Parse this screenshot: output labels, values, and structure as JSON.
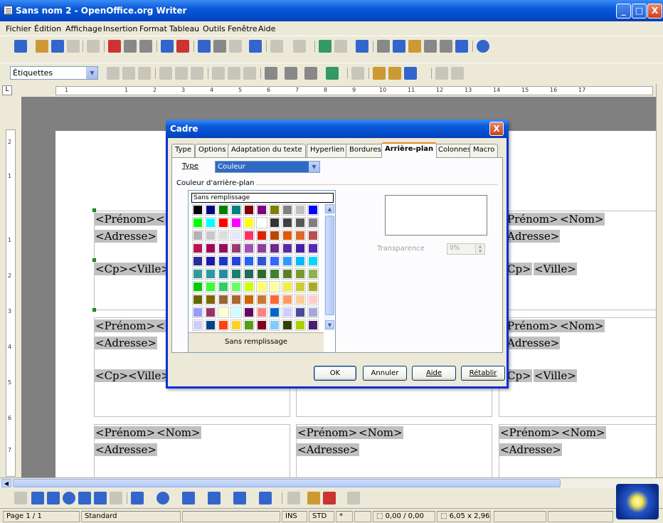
{
  "window": {
    "title": "Sans nom 2 - OpenOffice.org Writer",
    "min": "_",
    "max": "□",
    "close": "X"
  },
  "menu": [
    "Fichier",
    "Édition",
    "Affichage",
    "Insertion",
    "Format",
    "Tableau",
    "Outils",
    "Fenêtre",
    "Aide"
  ],
  "format_toolbar": {
    "style_value": "Étiquettes"
  },
  "ruler": {
    "marks": [
      "1",
      "1",
      "2",
      "3",
      "4",
      "5",
      "6",
      "7",
      "8",
      "9",
      "10",
      "11",
      "12",
      "13",
      "14",
      "15",
      "16",
      "17"
    ]
  },
  "vruler": {
    "marks": [
      "2",
      "1",
      "1",
      "2",
      "3",
      "4",
      "5",
      "6",
      "7"
    ]
  },
  "labels": {
    "prenom": "<Prénom>",
    "nom": "<Nom>",
    "adresse": "<Adresse>",
    "cp": "<Cp>",
    "ville": "<Ville>",
    "prenom_clip": "Prénom>",
    "adresse_clip": "Adresse>",
    "cp_clip": "Cp>",
    "prenom_l": "<Prénom>",
    "prenom_ll": "<"
  },
  "dialog": {
    "title": "Cadre",
    "close": "X",
    "tabs": [
      "Type",
      "Options",
      "Adaptation du texte",
      "Hyperlien",
      "Bordures",
      "Arrière-plan",
      "Colonnes",
      "Macro"
    ],
    "active_tab": "Arrière-plan",
    "type_label": "Type",
    "type_value": "Couleur",
    "group_label": "Couleur d'arrière-plan",
    "no_fill_top": "Sans remplissage",
    "no_fill_caption": "Sans remplissage",
    "transparency_label": "Transparence",
    "transparency_value": "0%",
    "buttons": {
      "ok": "OK",
      "cancel": "Annuler",
      "help": "Aide",
      "reset": "Rétablir"
    }
  },
  "palette_colors": [
    [
      "#000000",
      "#000080",
      "#008000",
      "#008080",
      "#800000",
      "#800080",
      "#808000",
      "#808080",
      "#c0c0c0",
      "#0000ff"
    ],
    [
      "#00ff00",
      "#00ffff",
      "#ff0000",
      "#ff00ff",
      "#ffff00",
      "#ffffff",
      "#333333",
      "#404040",
      "#595959",
      "#7f7f7f"
    ],
    [
      "#b3b3b3",
      "#c8c8c8",
      "#dddddd",
      "#e6e6ff",
      "#ff3366",
      "#dc2300",
      "#b84700",
      "#e05a00",
      "#e0662a",
      "#b85050"
    ],
    [
      "#b8134f",
      "#a5005b",
      "#940e5e",
      "#983c76",
      "#a050b8",
      "#8c3f99",
      "#6b2a90",
      "#5c2aa5",
      "#4520a5",
      "#5928b5"
    ],
    [
      "#2b2b9a",
      "#1a1aa8",
      "#1e36c8",
      "#2244dd",
      "#2266ee",
      "#2c56d8",
      "#3366ff",
      "#3399ff",
      "#00b8ff",
      "#00d8ff"
    ],
    [
      "#339999",
      "#2a9aa0",
      "#248ea0",
      "#17806d",
      "#1f6a5a",
      "#2e6b2b",
      "#3f7f30",
      "#5c7e2a",
      "#7a9a30",
      "#8cb34d"
    ],
    [
      "#00cc00",
      "#33ff33",
      "#33cc66",
      "#66ff66",
      "#ccff00",
      "#ffff66",
      "#ffff99",
      "#eeee44",
      "#cccc33",
      "#aaaa22"
    ],
    [
      "#666600",
      "#806600",
      "#996633",
      "#aa6633",
      "#cc6600",
      "#cc7733",
      "#ff6633",
      "#ff9966",
      "#ffcc99",
      "#ffcccc"
    ],
    [
      "#9999ff",
      "#993366",
      "#ffffcc",
      "#ccffff",
      "#660066",
      "#ff8080",
      "#0066cc",
      "#ccccff",
      "#4a4a9a",
      "#a8a8d8"
    ],
    [
      "#ccccff",
      "#004586",
      "#ff420e",
      "#ffd320",
      "#579d1c",
      "#7e0021",
      "#83caff",
      "#314004",
      "#aecf00",
      "#4b1f6f"
    ]
  ],
  "status": {
    "page": "Page 1 / 1",
    "style": "Standard",
    "ins": "INS",
    "std": "STD",
    "star": "*",
    "position": "0,00 / 0,00",
    "size": "6,05 x 2,96"
  }
}
